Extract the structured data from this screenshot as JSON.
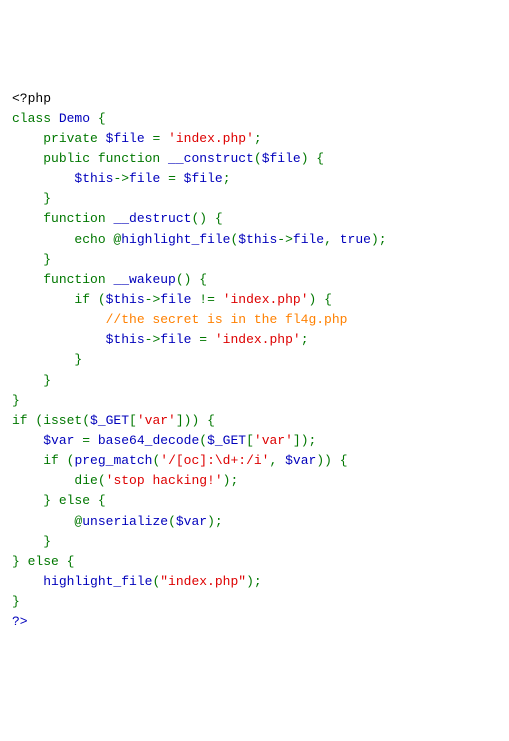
{
  "code": {
    "lines": [
      {
        "tokens": [
          {
            "cls": "def",
            "text": "<?php"
          }
        ]
      },
      {
        "tokens": [
          {
            "cls": "kw",
            "text": "class "
          },
          {
            "cls": "var",
            "text": "Demo "
          },
          {
            "cls": "kw",
            "text": "{"
          }
        ]
      },
      {
        "tokens": [
          {
            "cls": "def",
            "text": "    "
          },
          {
            "cls": "kw",
            "text": "private "
          },
          {
            "cls": "var",
            "text": "$file "
          },
          {
            "cls": "kw",
            "text": "= "
          },
          {
            "cls": "str",
            "text": "'index.php'"
          },
          {
            "cls": "kw",
            "text": ";"
          }
        ]
      },
      {
        "tokens": [
          {
            "cls": "def",
            "text": "    "
          },
          {
            "cls": "kw",
            "text": "public function "
          },
          {
            "cls": "var",
            "text": "__construct"
          },
          {
            "cls": "kw",
            "text": "("
          },
          {
            "cls": "var",
            "text": "$file"
          },
          {
            "cls": "kw",
            "text": ") { "
          }
        ]
      },
      {
        "tokens": [
          {
            "cls": "def",
            "text": "        "
          },
          {
            "cls": "var",
            "text": "$this"
          },
          {
            "cls": "kw",
            "text": "->"
          },
          {
            "cls": "var",
            "text": "file "
          },
          {
            "cls": "kw",
            "text": "= "
          },
          {
            "cls": "var",
            "text": "$file"
          },
          {
            "cls": "kw",
            "text": "; "
          }
        ]
      },
      {
        "tokens": [
          {
            "cls": "def",
            "text": "    "
          },
          {
            "cls": "kw",
            "text": "}"
          }
        ]
      },
      {
        "tokens": [
          {
            "cls": "def",
            "text": "    "
          },
          {
            "cls": "kw",
            "text": "function "
          },
          {
            "cls": "var",
            "text": "__destruct"
          },
          {
            "cls": "kw",
            "text": "() { "
          }
        ]
      },
      {
        "tokens": [
          {
            "cls": "def",
            "text": "        "
          },
          {
            "cls": "kw",
            "text": "echo @"
          },
          {
            "cls": "var",
            "text": "highlight_file"
          },
          {
            "cls": "kw",
            "text": "("
          },
          {
            "cls": "var",
            "text": "$this"
          },
          {
            "cls": "kw",
            "text": "->"
          },
          {
            "cls": "var",
            "text": "file"
          },
          {
            "cls": "kw",
            "text": ", "
          },
          {
            "cls": "var",
            "text": "true"
          },
          {
            "cls": "kw",
            "text": "); "
          }
        ]
      },
      {
        "tokens": [
          {
            "cls": "def",
            "text": "    "
          },
          {
            "cls": "kw",
            "text": "}"
          }
        ]
      },
      {
        "tokens": [
          {
            "cls": "def",
            "text": "    "
          },
          {
            "cls": "kw",
            "text": "function "
          },
          {
            "cls": "var",
            "text": "__wakeup"
          },
          {
            "cls": "kw",
            "text": "() { "
          }
        ]
      },
      {
        "tokens": [
          {
            "cls": "def",
            "text": "        "
          },
          {
            "cls": "kw",
            "text": "if ("
          },
          {
            "cls": "var",
            "text": "$this"
          },
          {
            "cls": "kw",
            "text": "->"
          },
          {
            "cls": "var",
            "text": "file "
          },
          {
            "cls": "kw",
            "text": "!= "
          },
          {
            "cls": "str",
            "text": "'index.php'"
          },
          {
            "cls": "kw",
            "text": ") { "
          }
        ]
      },
      {
        "tokens": [
          {
            "cls": "def",
            "text": "            "
          },
          {
            "cls": "com",
            "text": "//the secret is in the fl4g.php"
          }
        ]
      },
      {
        "tokens": [
          {
            "cls": "def",
            "text": "            "
          },
          {
            "cls": "var",
            "text": "$this"
          },
          {
            "cls": "kw",
            "text": "->"
          },
          {
            "cls": "var",
            "text": "file "
          },
          {
            "cls": "kw",
            "text": "= "
          },
          {
            "cls": "str",
            "text": "'index.php'"
          },
          {
            "cls": "kw",
            "text": "; "
          }
        ]
      },
      {
        "tokens": [
          {
            "cls": "def",
            "text": "        "
          },
          {
            "cls": "kw",
            "text": "} "
          }
        ]
      },
      {
        "tokens": [
          {
            "cls": "def",
            "text": "    "
          },
          {
            "cls": "kw",
            "text": "} "
          }
        ]
      },
      {
        "tokens": [
          {
            "cls": "kw",
            "text": "}"
          }
        ]
      },
      {
        "tokens": [
          {
            "cls": "kw",
            "text": "if (isset("
          },
          {
            "cls": "var",
            "text": "$_GET"
          },
          {
            "cls": "kw",
            "text": "["
          },
          {
            "cls": "str",
            "text": "'var'"
          },
          {
            "cls": "kw",
            "text": "])) { "
          }
        ]
      },
      {
        "tokens": [
          {
            "cls": "def",
            "text": "    "
          },
          {
            "cls": "var",
            "text": "$var "
          },
          {
            "cls": "kw",
            "text": "= "
          },
          {
            "cls": "var",
            "text": "base64_decode"
          },
          {
            "cls": "kw",
            "text": "("
          },
          {
            "cls": "var",
            "text": "$_GET"
          },
          {
            "cls": "kw",
            "text": "["
          },
          {
            "cls": "str",
            "text": "'var'"
          },
          {
            "cls": "kw",
            "text": "]); "
          }
        ]
      },
      {
        "tokens": [
          {
            "cls": "def",
            "text": "    "
          },
          {
            "cls": "kw",
            "text": "if ("
          },
          {
            "cls": "var",
            "text": "preg_match"
          },
          {
            "cls": "kw",
            "text": "("
          },
          {
            "cls": "str",
            "text": "'/[oc]:\\d+:/i'"
          },
          {
            "cls": "kw",
            "text": ", "
          },
          {
            "cls": "var",
            "text": "$var"
          },
          {
            "cls": "kw",
            "text": ")) { "
          }
        ]
      },
      {
        "tokens": [
          {
            "cls": "def",
            "text": "        "
          },
          {
            "cls": "kw",
            "text": "die("
          },
          {
            "cls": "str",
            "text": "'stop hacking!'"
          },
          {
            "cls": "kw",
            "text": "); "
          }
        ]
      },
      {
        "tokens": [
          {
            "cls": "def",
            "text": "    "
          },
          {
            "cls": "kw",
            "text": "} else {"
          }
        ]
      },
      {
        "tokens": [
          {
            "cls": "def",
            "text": "        "
          },
          {
            "cls": "kw",
            "text": "@"
          },
          {
            "cls": "var",
            "text": "unserialize"
          },
          {
            "cls": "kw",
            "text": "("
          },
          {
            "cls": "var",
            "text": "$var"
          },
          {
            "cls": "kw",
            "text": "); "
          }
        ]
      },
      {
        "tokens": [
          {
            "cls": "def",
            "text": "    "
          },
          {
            "cls": "kw",
            "text": "} "
          }
        ]
      },
      {
        "tokens": [
          {
            "cls": "kw",
            "text": "} else { "
          }
        ]
      },
      {
        "tokens": [
          {
            "cls": "def",
            "text": "    "
          },
          {
            "cls": "var",
            "text": "highlight_file"
          },
          {
            "cls": "kw",
            "text": "("
          },
          {
            "cls": "str",
            "text": "\"index.php\""
          },
          {
            "cls": "kw",
            "text": "); "
          }
        ]
      },
      {
        "tokens": [
          {
            "cls": "kw",
            "text": "} "
          }
        ]
      },
      {
        "tokens": [
          {
            "cls": "var",
            "text": "?>"
          }
        ]
      }
    ]
  }
}
